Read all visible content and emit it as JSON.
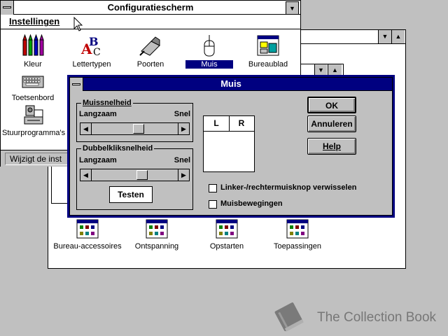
{
  "control_panel": {
    "title": "Configuratiescherm",
    "menu_label": "Instellingen",
    "icons": [
      {
        "label": "Kleur",
        "icon": "color-crayons-icon"
      },
      {
        "label": "Lettertypen",
        "icon": "fonts-icon"
      },
      {
        "label": "Poorten",
        "icon": "ports-icon"
      },
      {
        "label": "Muis",
        "icon": "mouse-icon"
      },
      {
        "label": "Bureaublad",
        "icon": "desktop-icon"
      },
      {
        "label": "Toetsenbord",
        "icon": "keyboard-icon"
      },
      {
        "label": "Stuurprogramma's",
        "icon": "drivers-icon"
      }
    ],
    "status_text": "Wijzigt de inst"
  },
  "mouse_dialog": {
    "title": "Muis",
    "speed": {
      "title": "Muissnelheid",
      "slow": "Langzaam",
      "fast": "Snel",
      "value": 0.55
    },
    "double_click": {
      "title": "Dubbelkliksnelheid",
      "slow": "Langzaam",
      "fast": "Snel",
      "value": 0.6,
      "test_label": "Testen"
    },
    "buttons": {
      "left": "L",
      "right": "R"
    },
    "ok_label": "OK",
    "cancel_label": "Annuleren",
    "help_label": "Help",
    "swap_label": "Linker-/rechtermuisknop verwisselen",
    "swap_checked": false,
    "trails_label": "Muisbewegingen",
    "trails_checked": false
  },
  "program_manager": {
    "groups": [
      "Bureau-accessoires",
      "Ontspanning",
      "Opstarten",
      "Toepassingen"
    ]
  },
  "watermark": {
    "text": "The Collection Book"
  },
  "colors": {
    "active_title": "#000080",
    "desktop": "#c0c0c0",
    "face": "#c0c0c0"
  }
}
